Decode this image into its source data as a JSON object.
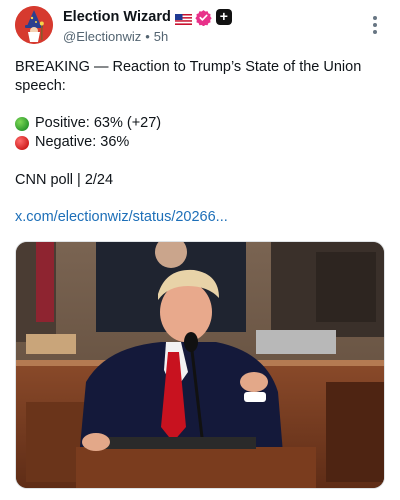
{
  "post": {
    "display_name": "Election Wizard",
    "handle": "@Electionwiz",
    "separator": "•",
    "time": "5h",
    "text_line1": "BREAKING — Reaction to Trump’s State of the Union speech:",
    "positive": "Positive: 63% (+27)",
    "negative": "Negative: 36%",
    "poll": "CNN poll | 2/24",
    "link": "x.com/electionwiz/status/20266..."
  },
  "icons": {
    "flag": "us-flag-icon",
    "verified": "verified-badge-icon",
    "plus": "plus-badge-icon",
    "more": "more-vertical-icon",
    "positive": "green-circle-icon",
    "negative": "red-circle-icon"
  },
  "colors": {
    "avatar_bg": "#d63a2f",
    "verified": "#e8318a",
    "link": "#1d6fb8",
    "positive": "#2e9a2e",
    "negative": "#d0201f"
  },
  "symbols": {
    "plus": "+"
  }
}
